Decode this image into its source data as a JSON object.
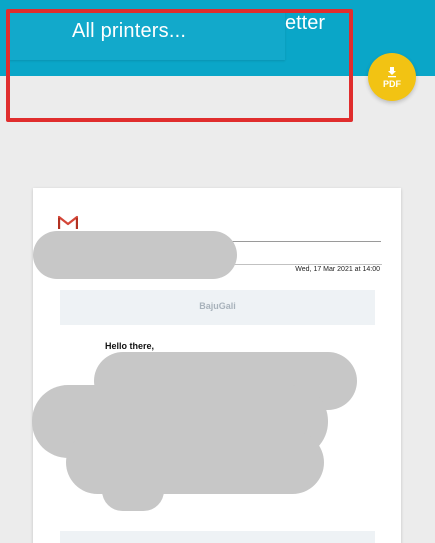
{
  "print_dialog": {
    "printer_select": {
      "selected": "All printers..."
    },
    "background_title_fragment": "etter",
    "pdf_button": {
      "icon": "download-icon",
      "label": "PDF"
    }
  },
  "preview": {
    "logo": "gmail-logo",
    "date": "Wed, 17 Mar 2021 at 14:00",
    "sender": "BajuGali",
    "greeting": "Hello there,"
  },
  "colors": {
    "toolbar": "#0aa6c8",
    "highlight": "#e02d2d",
    "fab": "#f2c313",
    "redaction": "#c7c7c7"
  }
}
